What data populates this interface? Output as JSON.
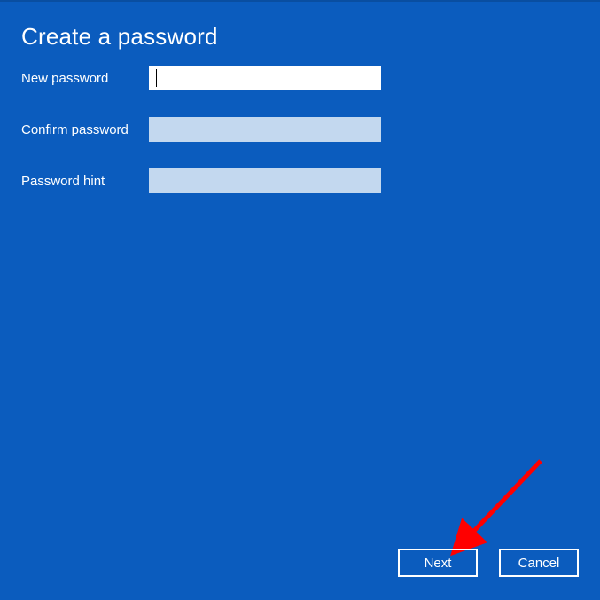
{
  "title": "Create a password",
  "form": {
    "new_password": {
      "label": "New password",
      "value": ""
    },
    "confirm_password": {
      "label": "Confirm password",
      "value": ""
    },
    "password_hint": {
      "label": "Password hint",
      "value": ""
    }
  },
  "buttons": {
    "next": "Next",
    "cancel": "Cancel"
  },
  "annotation": {
    "arrow_color": "#ff0000",
    "points_to": "next-button"
  }
}
